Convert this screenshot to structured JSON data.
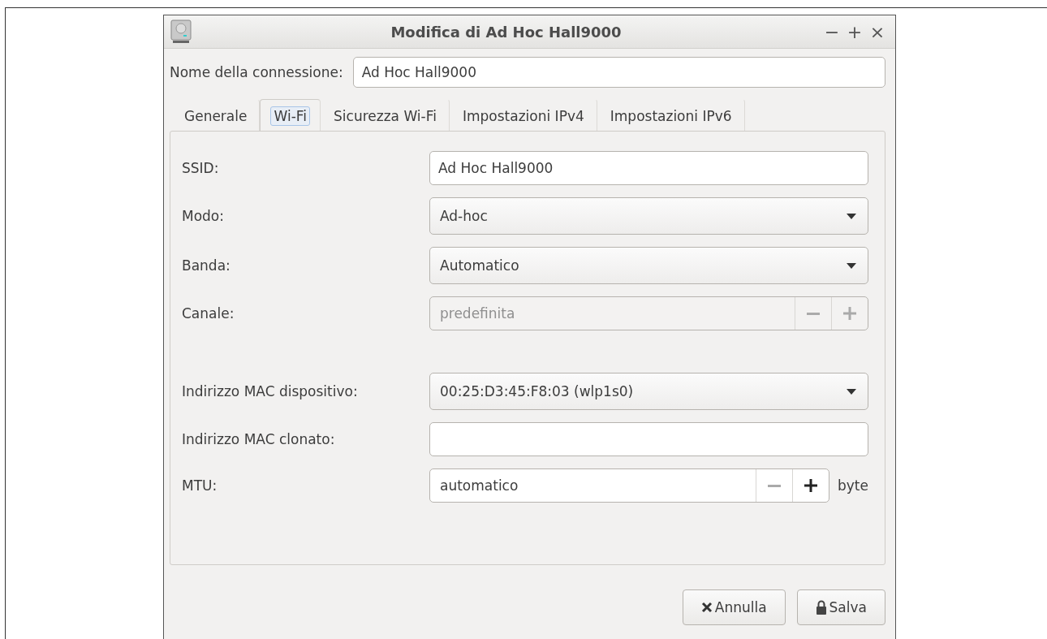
{
  "window": {
    "title": "Modifica di Ad Hoc Hall9000",
    "controls": [
      "−",
      "+",
      "×"
    ]
  },
  "connection_name": {
    "label": "Nome della connessione:",
    "value": "Ad Hoc Hall9000"
  },
  "tabs": [
    {
      "label": "Generale",
      "selected": false
    },
    {
      "label": "Wi-Fi",
      "selected": true
    },
    {
      "label": "Sicurezza Wi-Fi",
      "selected": false
    },
    {
      "label": "Impostazioni IPv4",
      "selected": false
    },
    {
      "label": "Impostazioni IPv6",
      "selected": false
    }
  ],
  "rows": [
    {
      "kind": "field",
      "label": "SSID:",
      "value": "Ad Hoc Hall9000"
    },
    {
      "kind": "combo",
      "label": "Modo:",
      "value": "Ad-hoc"
    },
    {
      "kind": "combo",
      "label": "Banda:",
      "value": "Automatico"
    },
    {
      "kind": "spin",
      "label": "Canale:",
      "value": "predefinita",
      "disabled": true,
      "minus_disabled": true,
      "plus_disabled": true
    },
    {
      "kind": "spacer"
    },
    {
      "kind": "combo",
      "label": "Indirizzo MAC dispositivo:",
      "value": "00:25:D3:45:F8:03 (wlp1s0)"
    },
    {
      "kind": "field",
      "label": "Indirizzo MAC clonato:",
      "value": ""
    },
    {
      "kind": "spin",
      "label": "MTU:",
      "value": "automatico",
      "disabled": false,
      "minus_disabled": true,
      "plus_disabled": false,
      "unit": "byte"
    }
  ],
  "buttons": [
    {
      "kind": "cancel",
      "label": "Annulla"
    },
    {
      "kind": "save",
      "label": "Salva"
    }
  ]
}
